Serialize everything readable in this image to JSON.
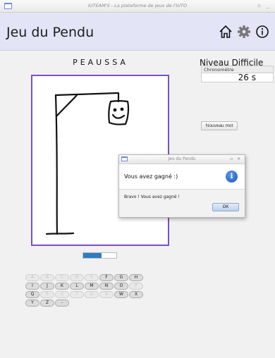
{
  "window": {
    "title": "IUTEAM'S - La plateforme de jeux de l'IUTO",
    "controls": "▫ _"
  },
  "header": {
    "title": "Jeu du Pendu",
    "home_icon": "home-icon",
    "settings_icon": "gear-icon",
    "info_icon": "info-icon"
  },
  "game": {
    "hidden_word": "PEAUSSA",
    "level": "Niveau Difficile"
  },
  "timer": {
    "label": "Chronomètre",
    "value": "26 s"
  },
  "new_word_label": "Nouveau mot",
  "progress": {
    "fraction": 0.55,
    "color": "#2e7cc8"
  },
  "keyboard": {
    "rows": [
      [
        {
          "l": "A",
          "on": false
        },
        {
          "l": "B",
          "on": false
        },
        {
          "l": "C",
          "on": false
        },
        {
          "l": "D",
          "on": false
        },
        {
          "l": "E",
          "on": false
        },
        {
          "l": "F",
          "on": true
        },
        {
          "l": "G",
          "on": true
        },
        {
          "l": "H",
          "on": true
        }
      ],
      [
        {
          "l": "I",
          "on": true
        },
        {
          "l": "J",
          "on": true
        },
        {
          "l": "K",
          "on": true
        },
        {
          "l": "L",
          "on": true
        },
        {
          "l": "M",
          "on": true
        },
        {
          "l": "N",
          "on": true
        },
        {
          "l": "O",
          "on": true
        },
        {
          "l": "P",
          "on": false
        }
      ],
      [
        {
          "l": "Q",
          "on": true
        },
        {
          "l": "R",
          "on": false
        },
        {
          "l": "S",
          "on": false
        },
        {
          "l": "T",
          "on": false
        },
        {
          "l": "U",
          "on": false
        },
        {
          "l": "V",
          "on": false
        },
        {
          "l": "W",
          "on": true
        },
        {
          "l": "X",
          "on": true
        }
      ],
      [
        {
          "l": "Y",
          "on": true
        },
        {
          "l": "Z",
          "on": true
        },
        {
          "l": "-",
          "on": true
        }
      ]
    ]
  },
  "dialog": {
    "title": "Jeu du Pendu",
    "controls": "▫ ✕",
    "header": "Vous avez gagné :)",
    "body": "Bravo ! Vous avez gagné !",
    "ok": "OK"
  },
  "colors": {
    "accent": "#7a4fc2",
    "header_bg": "#e4e4f7"
  }
}
